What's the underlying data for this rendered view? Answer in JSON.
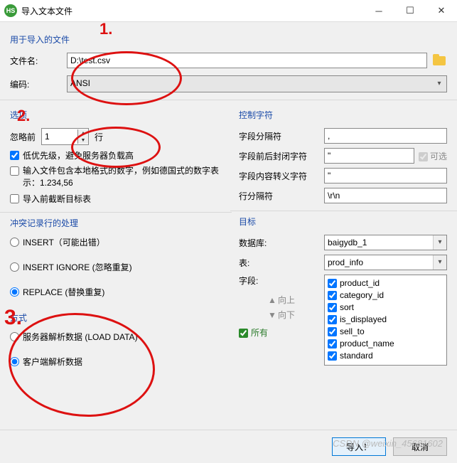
{
  "window": {
    "title": "导入文本文件",
    "app_icon_text": "HS"
  },
  "file_section": {
    "header": "用于导入的文件",
    "filename_label": "文件名:",
    "filename_value": "D:\\test.csv",
    "encoding_label": "编码:",
    "encoding_value": "ANSI"
  },
  "options": {
    "header": "选项",
    "ignore_label": "忽略前",
    "ignore_value": "1",
    "ignore_unit": "行",
    "low_priority": "低优先级，避免服务器负载高",
    "local_number": "输入文件包含本地格式的数字，例如德国式的数字表示：1.234,56",
    "truncate": "导入前截断目标表"
  },
  "control_chars": {
    "header": "控制字符",
    "field_sep_label": "字段分隔符",
    "field_sep_value": ",",
    "enclose_label": "字段前后封闭字符",
    "enclose_value": "\"",
    "enclose_opt": "可选",
    "escape_label": "字段内容转义字符",
    "escape_value": "\"",
    "line_sep_label": "行分隔符",
    "line_sep_value": "\\r\\n"
  },
  "conflict": {
    "header": "冲突记录行的处理",
    "insert": "INSERT（可能出错）",
    "insert_ignore": "INSERT IGNORE (忽略重复)",
    "replace": "REPLACE (替换重复)"
  },
  "method": {
    "header": "方式",
    "server": "服务器解析数据 (LOAD DATA)",
    "client": "客户端解析数据"
  },
  "target": {
    "header": "目标",
    "db_label": "数据库:",
    "db_value": "baigydb_1",
    "table_label": "表:",
    "table_value": "prod_info",
    "fields_label": "字段:",
    "move_up": "向上",
    "move_down": "向下",
    "all": "所有",
    "fields": [
      "product_id",
      "category_id",
      "sort",
      "is_displayed",
      "sell_to",
      "product_name",
      "standard"
    ]
  },
  "buttons": {
    "import": "导入！",
    "cancel": "取消"
  },
  "annotations": {
    "a1": "1.",
    "a2": "2.",
    "a3": "3."
  },
  "watermark": "CSDN @weixin_45681602"
}
